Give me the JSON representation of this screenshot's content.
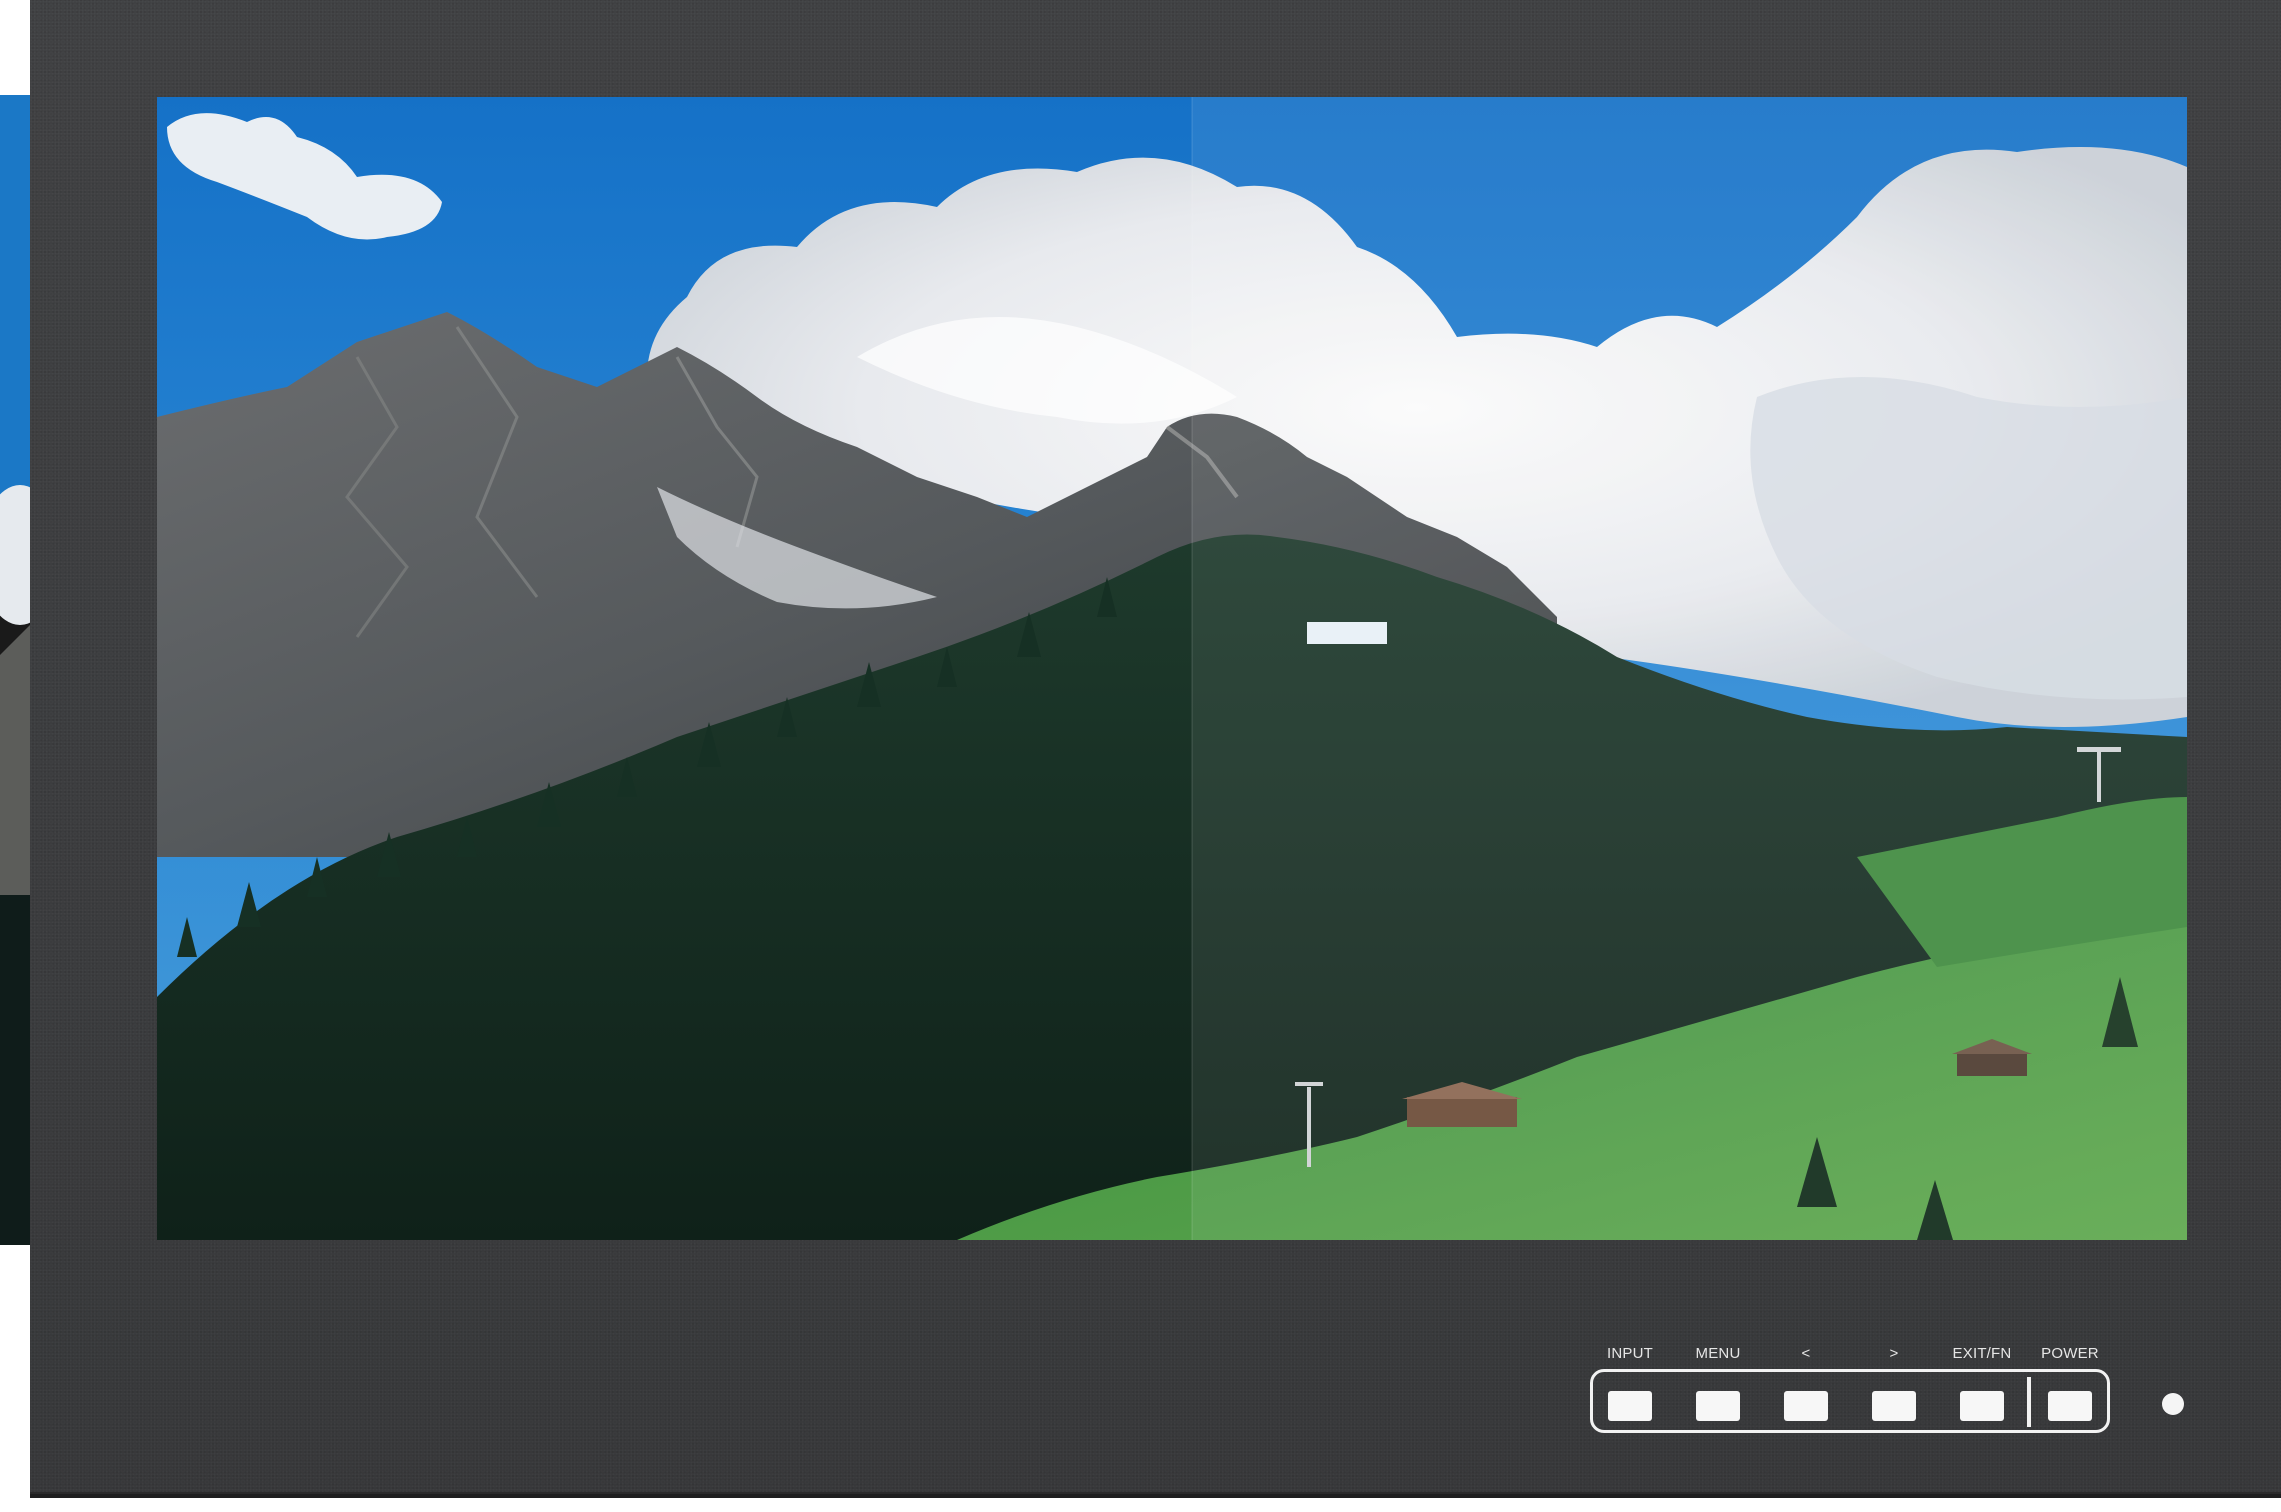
{
  "controls": {
    "buttons": [
      {
        "label": "INPUT"
      },
      {
        "label": "MENU"
      },
      {
        "label": "<"
      },
      {
        "label": ">"
      },
      {
        "label": "EXIT/FN"
      },
      {
        "label": "POWER"
      }
    ]
  },
  "screen": {
    "image": "alpine-mountain-landscape",
    "split_comparison": true
  },
  "colors": {
    "bezel": "#3d3e40",
    "sky": "#1e7fcf",
    "button": "#f7f7f7"
  }
}
